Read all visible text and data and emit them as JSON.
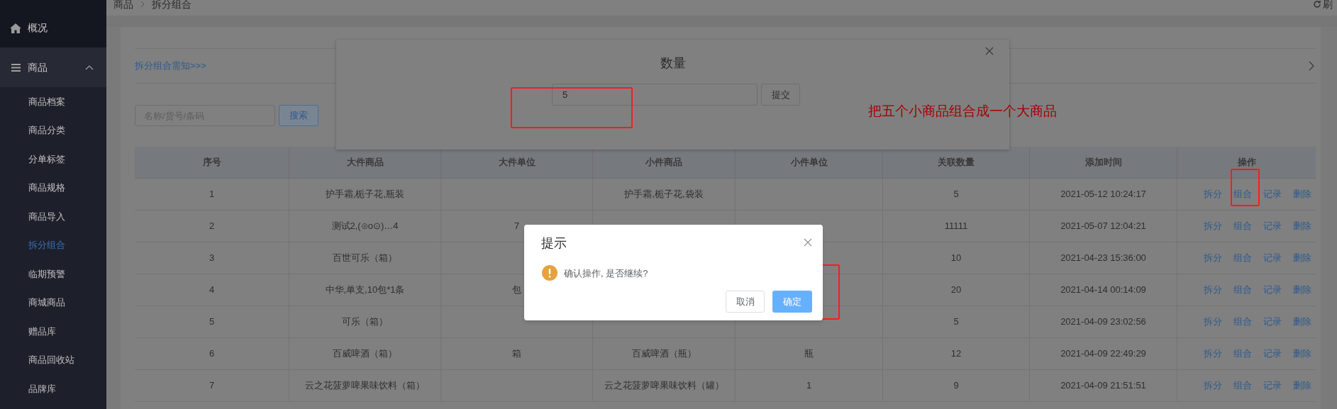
{
  "sidebar": {
    "items": [
      {
        "label": "概况",
        "kind": "link",
        "selected": false
      },
      {
        "label": "商品",
        "kind": "group",
        "expanded": true,
        "children": [
          {
            "label": "商品档案",
            "selected": false
          },
          {
            "label": "商品分类",
            "selected": false
          },
          {
            "label": "分单标签",
            "selected": false
          },
          {
            "label": "商品规格",
            "selected": false
          },
          {
            "label": "商品导入",
            "selected": false
          },
          {
            "label": "拆分组合",
            "selected": true
          },
          {
            "label": "临期预警",
            "selected": false
          },
          {
            "label": "商城商品",
            "selected": false
          },
          {
            "label": "赠品库",
            "selected": false
          },
          {
            "label": "商品回收站",
            "selected": false
          },
          {
            "label": "品牌库",
            "selected": false
          }
        ]
      }
    ]
  },
  "breadcrumb": [
    "商品",
    "拆分组合"
  ],
  "refresh_button": {
    "label": "刷"
  },
  "notice_link": "拆分组合需知>>>",
  "search": {
    "placeholder": "名称/货号/条码",
    "button": "搜索"
  },
  "table": {
    "columns": [
      "序号",
      "大件商品",
      "大件单位",
      "小件商品",
      "小件单位",
      "关联数量",
      "添加时间",
      "操作"
    ],
    "rows": [
      {
        "no": "1",
        "big_item": "护手霜,栀子花,瓶装",
        "small_item": "护手霜,栀子花,袋装",
        "qty": "5",
        "added": "2021-05-12 10:24:17",
        "actions": [
          "拆分",
          "组合",
          "记录",
          "删除"
        ]
      },
      {
        "no": "2",
        "big_item": "测试2,(⊙o⊙)…4",
        "big_unit": "7",
        "qty": "11111",
        "added": "2021-05-07 12:04:21",
        "actions": [
          "拆分",
          "组合",
          "记录",
          "删除"
        ]
      },
      {
        "no": "3",
        "big_item": "百世可乐（箱）",
        "qty": "10",
        "added": "2021-04-23 15:36:00",
        "actions": [
          "拆分",
          "组合",
          "记录",
          "删除"
        ]
      },
      {
        "no": "4",
        "big_item": "中华,单支,10包*1条",
        "big_unit": "包",
        "qty": "20",
        "added": "2021-04-14 00:14:09",
        "actions": [
          "拆分",
          "组合",
          "记录",
          "删除"
        ]
      },
      {
        "no": "5",
        "big_item": "可乐（箱）",
        "qty": "5",
        "added": "2021-04-09 23:02:56",
        "actions": [
          "拆分",
          "组合",
          "记录",
          "删除"
        ]
      },
      {
        "no": "6",
        "big_item": "百威啤酒（箱）",
        "big_unit": "箱",
        "small_item": "百威啤酒（瓶）",
        "small_unit": "瓶",
        "qty": "12",
        "added": "2021-04-09 22:49:29",
        "actions": [
          "拆分",
          "组合",
          "记录",
          "删除"
        ]
      },
      {
        "no": "7",
        "big_item": "云之花菠萝啤果味饮料（箱）",
        "small_item": "云之花菠萝啤果味饮料（罐）",
        "small_unit": "1",
        "qty": "9",
        "added": "2021-04-09 21:51:51",
        "actions": [
          "拆分",
          "组合",
          "记录",
          "删除"
        ]
      }
    ]
  },
  "quantity_dialog": {
    "title": "数量",
    "value": "5",
    "submit": "提交"
  },
  "confirm_dialog": {
    "title": "提示",
    "message": "确认操作, 是否继续?",
    "buttons": [
      {
        "label": "取消",
        "kind": "cancel"
      },
      {
        "label": "确定",
        "kind": "primary"
      }
    ]
  },
  "annotation": {
    "note": "把五个小商品组合成一个大商品"
  }
}
